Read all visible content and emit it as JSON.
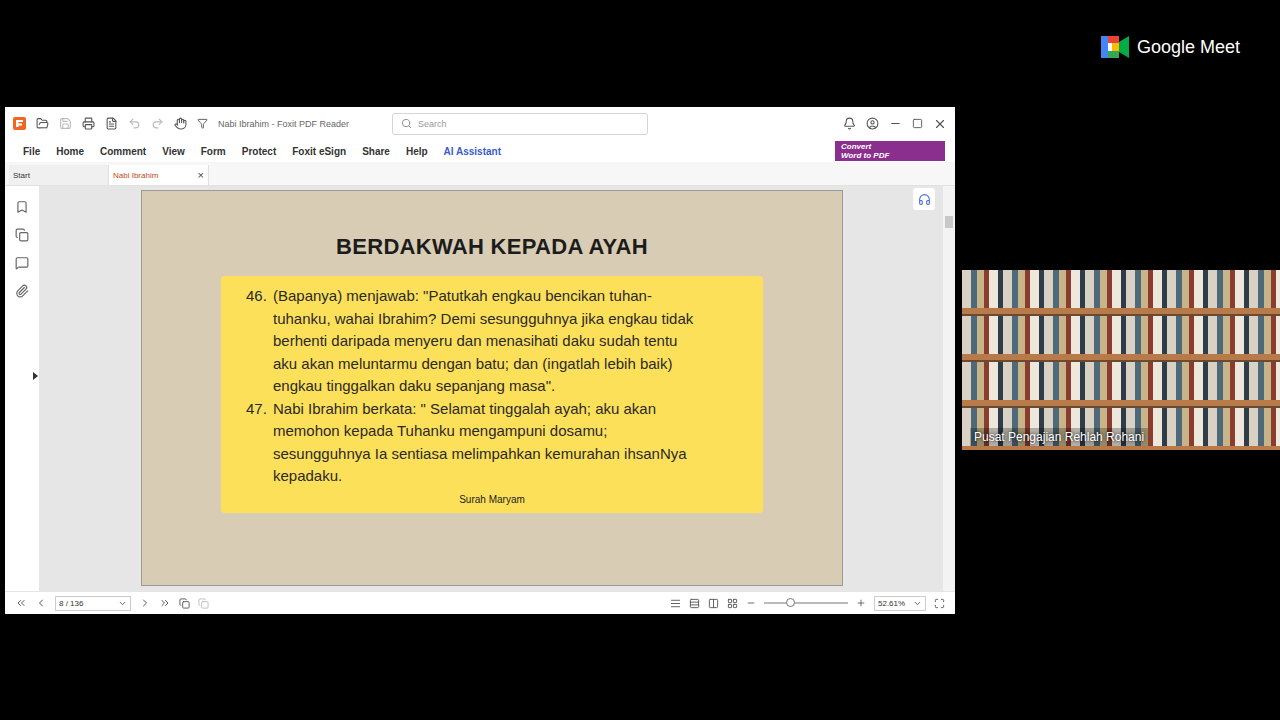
{
  "meet": {
    "logo": "Google Meet"
  },
  "window": {
    "title": "Nabi Ibrahim - Foxit PDF Reader"
  },
  "search": {
    "placeholder": "Search"
  },
  "menu": [
    {
      "label": "File",
      "accent": false
    },
    {
      "label": "Home",
      "accent": false
    },
    {
      "label": "Comment",
      "accent": false
    },
    {
      "label": "View",
      "accent": false
    },
    {
      "label": "Form",
      "accent": false
    },
    {
      "label": "Protect",
      "accent": false
    },
    {
      "label": "Foxit eSign",
      "accent": false
    },
    {
      "label": "Share",
      "accent": false
    },
    {
      "label": "Help",
      "accent": false
    },
    {
      "label": "AI Assistant",
      "accent": true
    }
  ],
  "convert": {
    "lines": [
      "Convert",
      "Word to PDF"
    ]
  },
  "tabs": [
    {
      "label": "Start",
      "selected": false,
      "closable": false
    },
    {
      "label": "Nabi Ibrahim",
      "selected": true,
      "closable": true
    }
  ],
  "close_glyph": "×",
  "page": {
    "title": "BERDAKWAH KEPADA AYAH",
    "verses": [
      {
        "number": "46.",
        "lines": [
          "(Bapanya) menjawab: \"Patutkah engkau bencikan tuhan-",
          "tuhanku, wahai Ibrahim? Demi sesungguhnya jika engkau tidak",
          "berhenti daripada menyeru dan menasihati daku sudah tentu",
          "aku akan meluntarmu dengan batu; dan (ingatlah lebih baik)",
          "engkau tinggalkan daku sepanjang masa\"."
        ]
      },
      {
        "number": "47.",
        "lines": [
          "Nabi Ibrahim berkata: \" Selamat tinggalah ayah; aku akan",
          "memohon kepada Tuhanku mengampuni dosamu;",
          "sesungguhnya Ia sentiasa melimpahkan kemurahan ihsanNya",
          "kepadaku."
        ]
      }
    ],
    "source": "Surah Maryam"
  },
  "status_bar": {
    "page": "8 / 136",
    "zoom": "52.61%",
    "zoom_level": 0.31
  },
  "participant": {
    "name": "Pusat Pengajian Rehlah Rohani"
  }
}
